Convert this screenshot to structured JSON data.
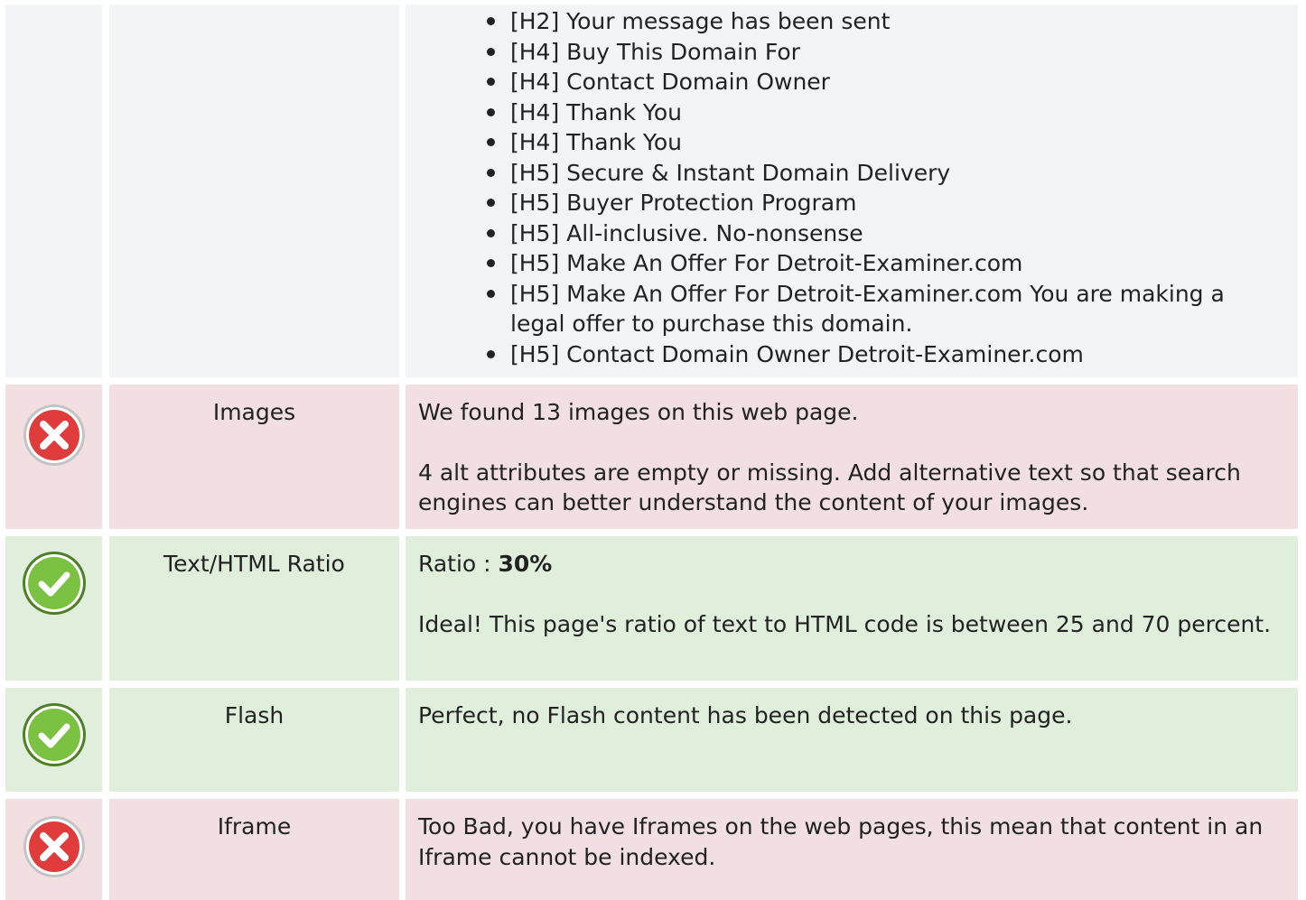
{
  "headings_list": [
    "[H2] Your message has been sent",
    "[H4] Buy This Domain For",
    "[H4] Contact Domain Owner",
    "[H4] Thank You",
    "[H4] Thank You",
    "[H5] Secure & Instant Domain Delivery",
    "[H5] Buyer Protection Program",
    "[H5] All-inclusive. No-nonsense",
    "[H5] Make An Offer For Detroit-Examiner.com",
    "[H5] Make An Offer For Detroit-Examiner.com You are making a legal offer to purchase this domain.",
    "[H5] Contact Domain Owner Detroit-Examiner.com"
  ],
  "checks": {
    "images": {
      "label": "Images",
      "status": "fail",
      "icon": "error-x-icon",
      "line1": "We found 13 images on this web page.",
      "line2": "4 alt attributes are empty or missing. Add alternative text so that search engines can better understand the content of your images."
    },
    "text_html_ratio": {
      "label": "Text/HTML Ratio",
      "status": "pass",
      "icon": "check-icon",
      "ratio_prefix": "Ratio : ",
      "ratio_value": "30%",
      "line2": "Ideal! This page's ratio of text to HTML code is between 25 and 70 percent."
    },
    "flash": {
      "label": "Flash",
      "status": "pass",
      "icon": "check-icon",
      "line1": "Perfect, no Flash content has been detected on this page."
    },
    "iframe": {
      "label": "Iframe",
      "status": "fail",
      "icon": "error-x-icon",
      "line1": "Too Bad, you have Iframes on the web pages, this mean that content in an Iframe cannot be indexed."
    }
  },
  "colors": {
    "fail_bg": "#f2dfe1",
    "pass_bg": "#e0efdb",
    "neutral_bg": "#f3f4f6",
    "error_red": "#e03c3c",
    "success_green": "#7cc242"
  }
}
